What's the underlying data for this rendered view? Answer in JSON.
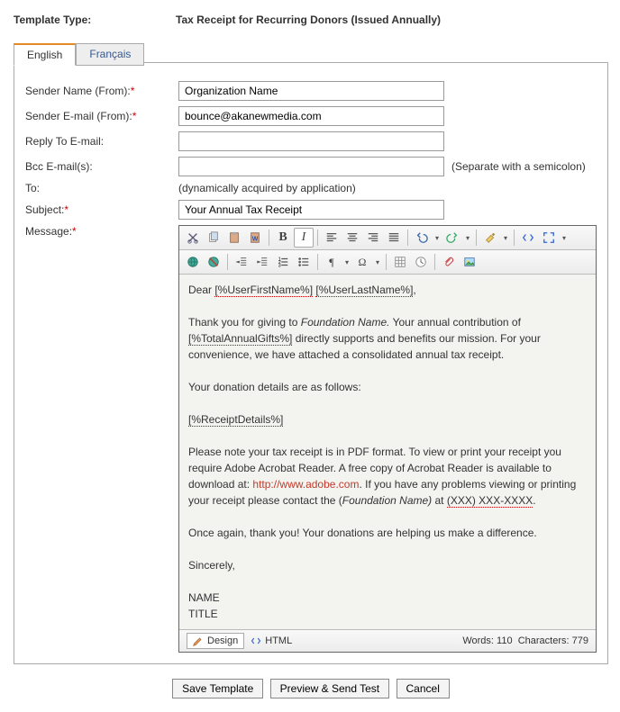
{
  "header": {
    "label": "Template Type:",
    "value": "Tax Receipt for Recurring Donors (Issued Annually)"
  },
  "tabs": {
    "english": "English",
    "francais": "Français"
  },
  "form": {
    "senderNameLabel": "Sender Name (From):",
    "senderNameValue": "Organization Name",
    "senderEmailLabel": "Sender E-mail (From):",
    "senderEmailValue": "bounce@akanewmedia.com",
    "replyToLabel": "Reply To E-mail:",
    "replyToValue": "",
    "bccLabel": "Bcc E-mail(s):",
    "bccValue": "",
    "bccNote": "(Separate with a semicolon)",
    "toLabel": "To:",
    "toValue": "(dynamically acquired by application)",
    "subjectLabel": "Subject:",
    "subjectValue": "Your Annual Tax Receipt",
    "messageLabel": "Message:"
  },
  "message": {
    "greeting_prefix": "Dear ",
    "greeting_token1": "[%UserFirstName%]",
    "greeting_token2": "[%UserLastName%]",
    "p1_a": "Thank you for giving to ",
    "p1_fn": "Foundation Name.",
    "p1_b": " Your annual contribution of ",
    "p1_token": "[%TotalAnnualGifts%]",
    "p1_c": " directly supports and benefits our mission.  For your convenience, we have attached a consolidated annual tax receipt.",
    "p2": "Your donation details are as follows:",
    "p3_token": "[%ReceiptDetails%]",
    "p4_a": "Please note your tax receipt is in PDF format.  To view or print your receipt you require Adobe Acrobat Reader. A free copy of Acrobat Reader is available to download at: ",
    "p4_link": "http://www.adobe.com",
    "p4_b": ".  If you have any problems viewing or printing your receipt please contact the (",
    "p4_fn": "Foundation Name)",
    "p4_c": " at ",
    "p4_phone": "(XXX) XXX-XXXX",
    "p4_d": ".",
    "p5": "Once again, thank you!  Your donations are helping us make a difference.",
    "sign1": "Sincerely,",
    "sign2": "NAME",
    "sign3": "TITLE"
  },
  "editor": {
    "designMode": "Design",
    "htmlMode": "HTML",
    "wordsLabel": "Words:",
    "wordsValue": "110",
    "charsLabel": "Characters:",
    "charsValue": "779"
  },
  "actions": {
    "save": "Save Template",
    "preview": "Preview & Send Test",
    "cancel": "Cancel"
  }
}
